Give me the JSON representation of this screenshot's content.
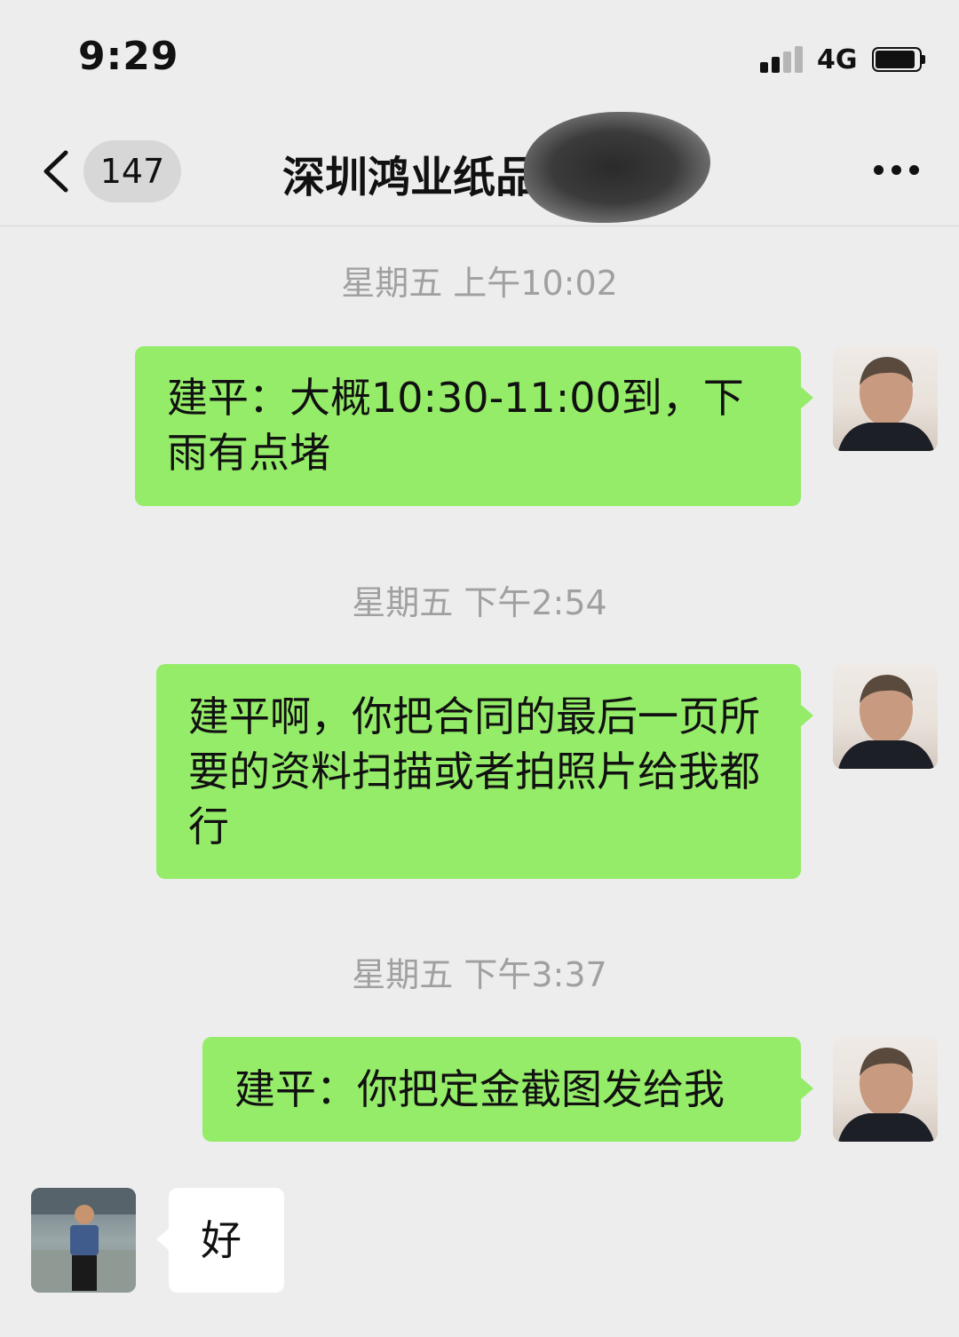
{
  "status_bar": {
    "time": "9:29",
    "network": "4G"
  },
  "header": {
    "back_icon": "chevron-left-icon",
    "unread_count": "147",
    "title": "深圳鸿业纸品",
    "more_icon": "more-dots-icon"
  },
  "messages": [
    {
      "timestamp": "星期五 上午10:02",
      "sender": "me",
      "text": "建平：大概10:30-11:00到，下雨有点堵"
    },
    {
      "timestamp": "星期五 下午2:54",
      "sender": "me",
      "text": "建平啊，你把合同的最后一页所要的资料扫描或者拍照片给我都行"
    },
    {
      "timestamp": "星期五 下午3:37",
      "sender": "me",
      "text": "建平：你把定金截图发给我"
    },
    {
      "timestamp": "",
      "sender": "other",
      "text": "好"
    }
  ],
  "colors": {
    "background": "#ededed",
    "outgoing_bubble": "#95ec69",
    "incoming_bubble": "#ffffff",
    "timestamp_text": "#a0a0a0"
  }
}
